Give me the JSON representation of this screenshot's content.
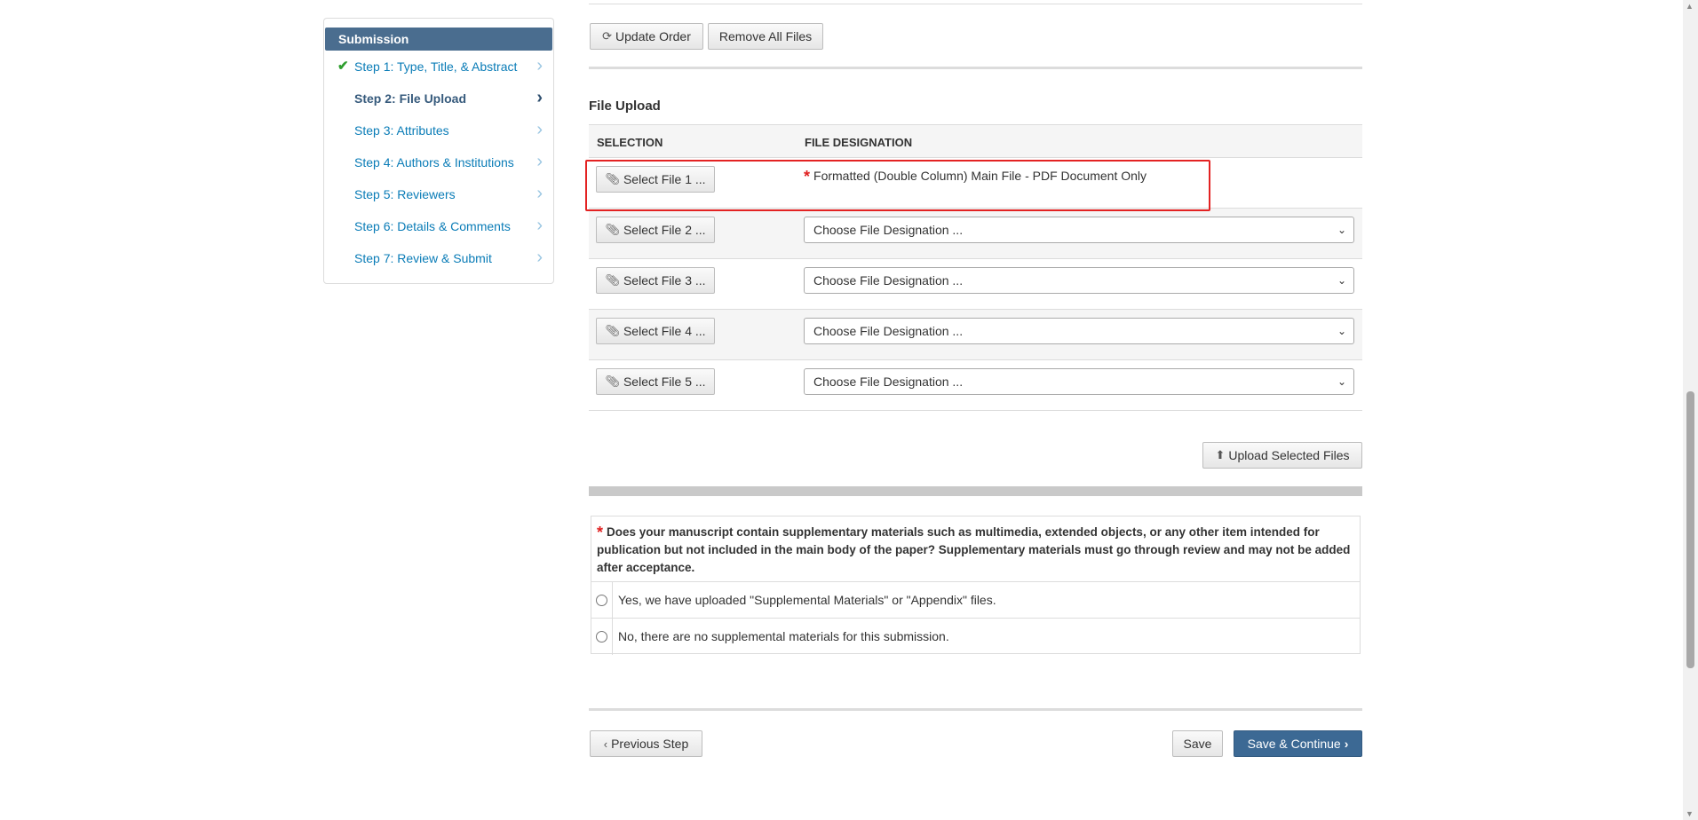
{
  "sidebar": {
    "header": "Submission",
    "items": [
      {
        "label": "Step 1: Type, Title, & Abstract"
      },
      {
        "label": "Step 2: File Upload"
      },
      {
        "label": "Step 3: Attributes"
      },
      {
        "label": "Step 4: Authors & Institutions"
      },
      {
        "label": "Step 5: Reviewers"
      },
      {
        "label": "Step 6: Details & Comments"
      },
      {
        "label": "Step 7: Review & Submit"
      }
    ],
    "completed_icon": "check-icon",
    "chevron_icon": "chevron-right-icon"
  },
  "toolbar": {
    "update_order": "Update Order",
    "remove_all": "Remove All Files"
  },
  "file_upload": {
    "title": "File Upload",
    "col_selection": "SELECTION",
    "col_designation": "FILE DESIGNATION",
    "rows": [
      {
        "button": "Select File 1 ...",
        "designation": "Formatted (Double Column) Main File - PDF Document Only"
      },
      {
        "button": "Select File 2 ...",
        "designation": "Choose File Designation ..."
      },
      {
        "button": "Select File 3 ...",
        "designation": "Choose File Designation ..."
      },
      {
        "button": "Select File 4 ...",
        "designation": "Choose File Designation ..."
      },
      {
        "button": "Select File 5 ...",
        "designation": "Choose File Designation ..."
      }
    ],
    "upload_button": "Upload Selected Files"
  },
  "supplemental": {
    "required_mark": "*",
    "question": "Does your manuscript contain supplementary materials such as multimedia, extended objects, or any other item intended for publication but not included in the main body of the paper? Supplementary materials must go through review and may not be added after acceptance.",
    "option_yes": "Yes, we have uploaded \"Supplemental Materials\" or \"Appendix\" files.",
    "option_no": "No, there are no supplemental materials for this submission."
  },
  "footer": {
    "previous": "Previous Step",
    "save": "Save",
    "save_continue": "Save & Continue"
  },
  "colors": {
    "sidebar_header": "#4a6d8f",
    "link": "#0a7cb7",
    "primary_button": "#3c6994",
    "required": "#e02020",
    "highlight_box": "#e32222"
  }
}
